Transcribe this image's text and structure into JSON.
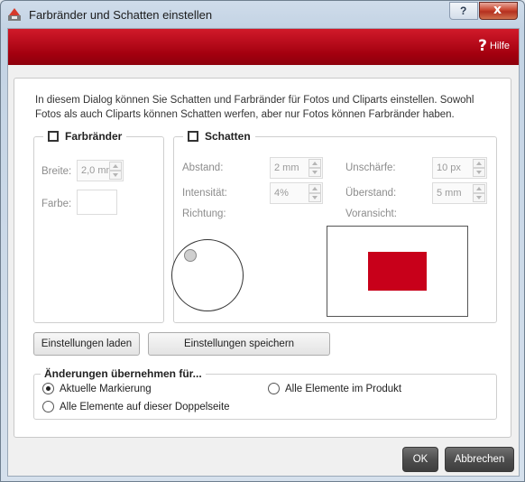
{
  "window": {
    "title": "Farbränder und Schatten einstellen",
    "close_label": "x",
    "help_top_label": "?"
  },
  "banner": {
    "help_label": "Hilfe",
    "help_glyph": "?",
    "color": "#b3000f"
  },
  "intro_text": "In diesem Dialog können Sie Schatten und Farbränder für Fotos und Cliparts einstellen. Sowohl Fotos als auch Cliparts können Schatten werfen, aber nur Fotos können Farbränder haben.",
  "borders": {
    "title": "Farbränder",
    "checked": false,
    "width_label": "Breite:",
    "width_value": "2,0 mm",
    "color_label": "Farbe:"
  },
  "shadow": {
    "title": "Schatten",
    "checked": false,
    "distance_label": "Abstand:",
    "distance_value": "2 mm",
    "intensity_label": "Intensität:",
    "intensity_value": "4%",
    "direction_label": "Richtung:",
    "blur_label": "Unschärfe:",
    "blur_value": "10 px",
    "overhang_label": "Überstand:",
    "overhang_value": "5 mm",
    "preview_label": "Voransicht:",
    "preview_color": "#c8001a"
  },
  "buttons": {
    "load": "Einstellungen laden",
    "save": "Einstellungen speichern",
    "ok": "OK",
    "cancel": "Abbrechen"
  },
  "apply": {
    "title": "Änderungen übernehmen für...",
    "options": [
      {
        "label": "Aktuelle Markierung",
        "selected": true
      },
      {
        "label": "Alle Elemente im Produkt",
        "selected": false
      },
      {
        "label": "Alle Elemente auf dieser Doppelseite",
        "selected": false
      }
    ]
  }
}
